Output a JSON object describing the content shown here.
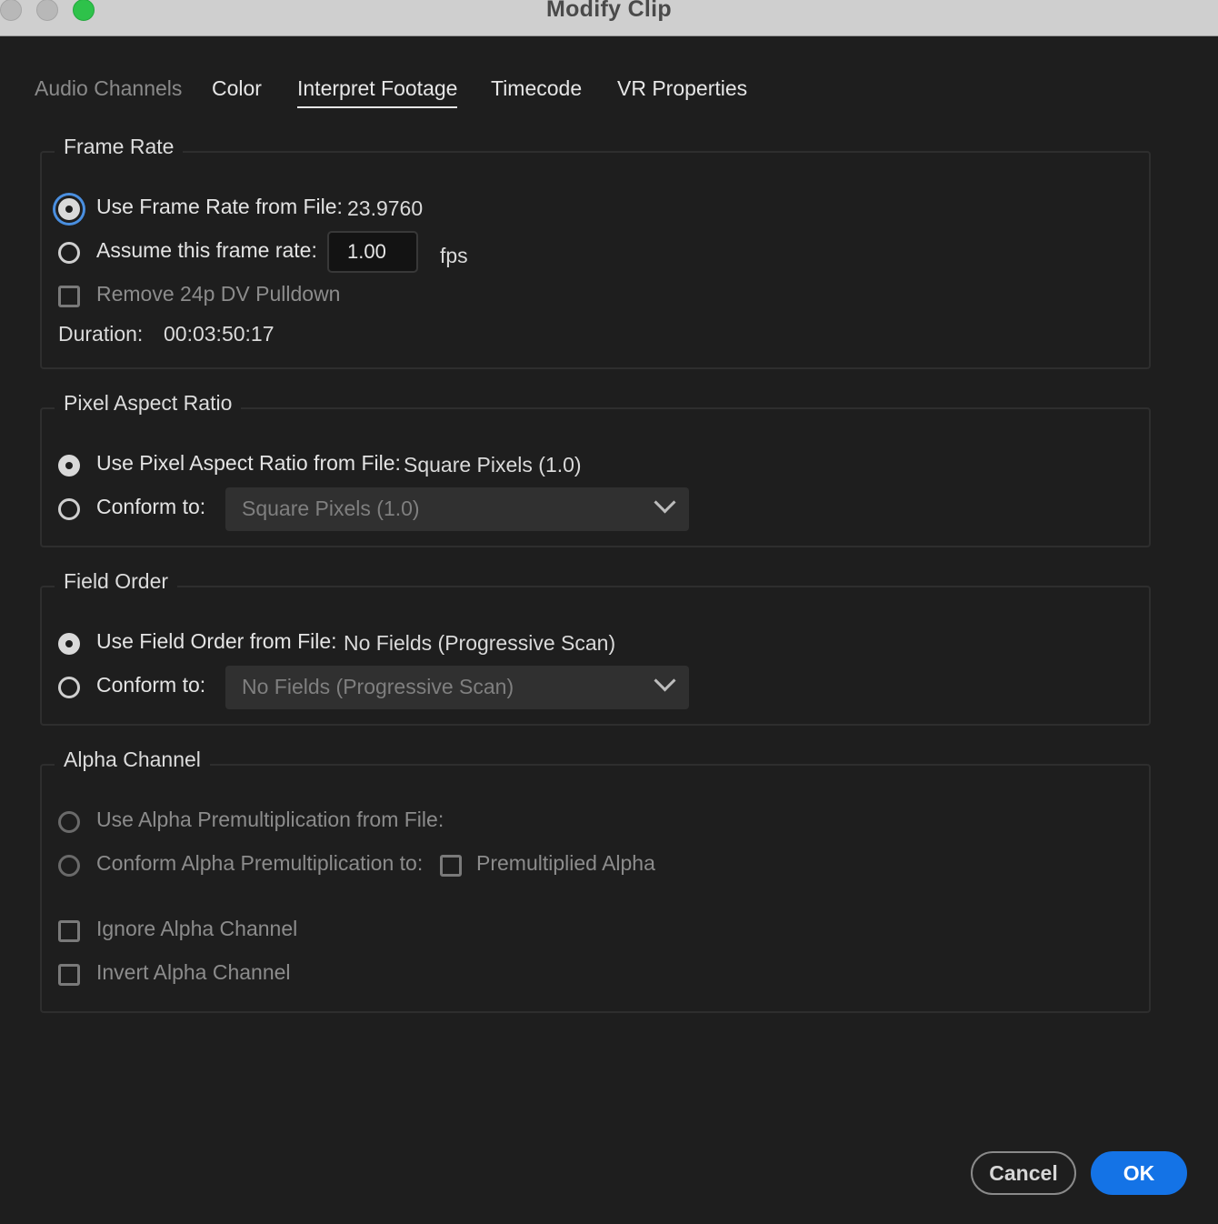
{
  "window": {
    "title": "Modify Clip"
  },
  "tabs": [
    {
      "label": "Audio Channels",
      "state": "disabled"
    },
    {
      "label": "Color",
      "state": "normal"
    },
    {
      "label": "Interpret Footage",
      "state": "active"
    },
    {
      "label": "Timecode",
      "state": "normal"
    },
    {
      "label": "VR Properties",
      "state": "normal"
    }
  ],
  "frame_rate": {
    "legend": "Frame Rate",
    "use_from_file_label": "Use Frame Rate from File:",
    "use_from_file_value": "23.9760",
    "use_from_file_selected": true,
    "assume_label": "Assume this frame rate:",
    "assume_value": "1.00",
    "assume_unit": "fps",
    "pulldown_label": "Remove 24p DV Pulldown",
    "pulldown_checked": false,
    "duration_label": "Duration:",
    "duration_value": "00:03:50:17"
  },
  "pixel_aspect": {
    "legend": "Pixel Aspect Ratio",
    "use_from_file_label": "Use Pixel Aspect Ratio from File:",
    "use_from_file_value": "Square Pixels (1.0)",
    "conform_label": "Conform to:",
    "conform_value": "Square Pixels (1.0)"
  },
  "field_order": {
    "legend": "Field Order",
    "use_from_file_label": "Use Field Order from File:",
    "use_from_file_value": "No Fields (Progressive Scan)",
    "conform_label": "Conform to:",
    "conform_value": "No Fields (Progressive Scan)"
  },
  "alpha": {
    "legend": "Alpha Channel",
    "use_from_file_label": "Use Alpha Premultiplication from File:",
    "conform_label": "Conform Alpha Premultiplication to:",
    "premultiplied_label": "Premultiplied Alpha",
    "ignore_label": "Ignore Alpha Channel",
    "invert_label": "Invert Alpha Channel"
  },
  "buttons": {
    "cancel": "Cancel",
    "ok": "OK"
  },
  "colors": {
    "accent": "#1473e6",
    "focus_ring": "#4a8fe0",
    "background": "#1e1e1e",
    "zoom_green": "#2ec24a"
  }
}
